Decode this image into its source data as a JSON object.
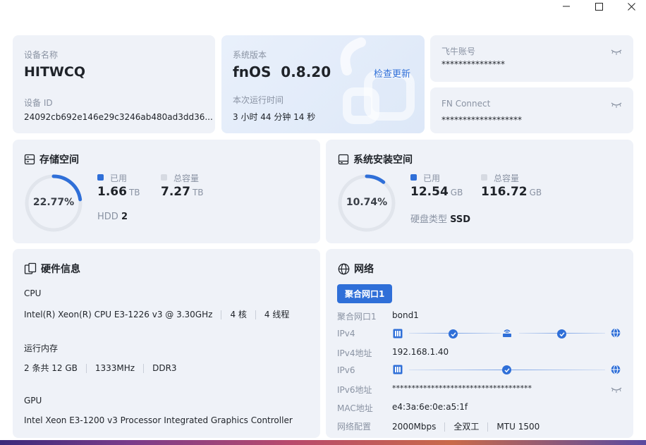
{
  "window": {
    "minimize_icon": "minimize-icon",
    "maximize_icon": "maximize-icon",
    "close_icon": "close-icon"
  },
  "device": {
    "name_label": "设备名称",
    "name": "HITWCQ",
    "id_label": "设备 ID",
    "id": "24092cb692e146e29c3246ab480ad3dd36..."
  },
  "system": {
    "version_label": "系统版本",
    "version": "fnOS  0.8.20",
    "check_update": "检查更新",
    "uptime_label": "本次运行时间",
    "uptime": "3 小时 44 分钟 14 秒"
  },
  "account": {
    "label": "飞牛账号",
    "value": "***************"
  },
  "fnconnect": {
    "label": "FN Connect",
    "value": "*******************"
  },
  "storage": {
    "title": "存储空间",
    "percent": "22.77%",
    "percent_value": 22.77,
    "used_label": "已用",
    "used": "1.66",
    "used_unit": "TB",
    "total_label": "总容量",
    "total": "7.27",
    "total_unit": "TB",
    "hdd_label": "HDD",
    "hdd_count": "2"
  },
  "sysdisk": {
    "title": "系统安装空间",
    "percent": "10.74%",
    "percent_value": 10.74,
    "used_label": "已用",
    "used": "12.54",
    "used_unit": "GB",
    "total_label": "总容量",
    "total": "116.72",
    "total_unit": "GB",
    "type_label": "硬盘类型",
    "type": "SSD"
  },
  "hardware": {
    "title": "硬件信息",
    "cpu_label": "CPU",
    "cpu_model": "Intel(R) Xeon(R) CPU E3-1226 v3 @ 3.30GHz",
    "cpu_cores": "4 核",
    "cpu_threads": "4 线程",
    "mem_label": "运行内存",
    "mem_size": "2 条共 12 GB",
    "mem_speed": "1333MHz",
    "mem_type": "DDR3",
    "gpu_label": "GPU",
    "gpu_model": "Intel Xeon E3-1200 v3 Processor Integrated Graphics Controller"
  },
  "network": {
    "title": "网络",
    "tab": "聚合网口1",
    "iface_label": "聚合网口1",
    "iface": "bond1",
    "ipv4_label": "IPv4",
    "ipv4_addr_label": "IPv4地址",
    "ipv4_addr": "192.168.1.40",
    "ipv6_label": "IPv6",
    "ipv6_addr_label": "IPv6地址",
    "ipv6_addr": "************************************",
    "mac_label": "MAC地址",
    "mac": "e4:3a:6e:0e:a5:1f",
    "config_label": "网络配置",
    "speed": "2000Mbps",
    "duplex": "全双工",
    "mtu": "MTU 1500"
  },
  "colors": {
    "accent": "#2f6fd8",
    "card_bg": "#eff2f8",
    "ring_track": "#e1e5ec",
    "muted_text": "#8a93a3",
    "used_legend": "#2f6fd8",
    "total_legend": "#d6dae2"
  }
}
